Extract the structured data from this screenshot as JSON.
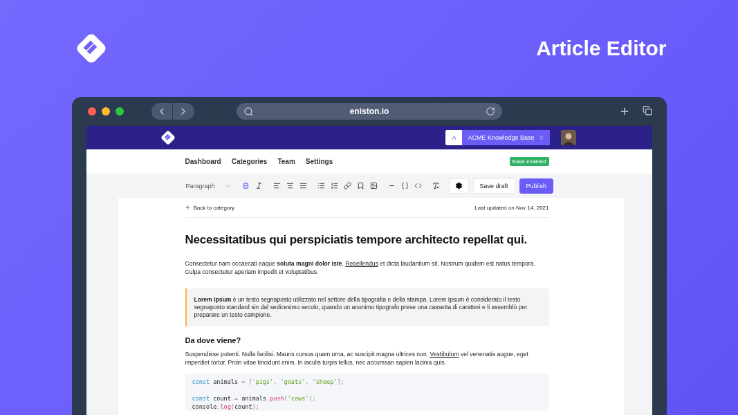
{
  "hero": {
    "title": "Article Editor"
  },
  "browser": {
    "url": "eniston.io"
  },
  "app_header": {
    "workspace_initial": "A",
    "workspace_name": "ACME Knowledge Base"
  },
  "nav": {
    "items": [
      {
        "label": "Dashboard"
      },
      {
        "label": "Categories"
      },
      {
        "label": "Team"
      },
      {
        "label": "Settings"
      }
    ],
    "badge": "Base enabled"
  },
  "toolbar": {
    "block_type": "Paragraph",
    "tools": [
      [
        {
          "active": true
        },
        {
          "active": false
        }
      ],
      [
        {
          "active": false
        },
        {
          "active": false
        },
        {
          "active": false
        }
      ],
      [
        {
          "active": false
        },
        {
          "active": false
        },
        {
          "active": false
        },
        {
          "active": false
        },
        {
          "active": false
        }
      ],
      [
        {
          "active": false
        },
        {
          "active": false
        },
        {
          "active": false
        }
      ],
      [
        {
          "active": false
        }
      ]
    ],
    "save_label": "Save draft",
    "publish_label": "Publish"
  },
  "article": {
    "back_link": "Back to category",
    "updated": "Last updated on Nov 14, 2021",
    "title": "Necessitatibus qui perspiciatis tempore architecto repellat qui.",
    "blocks": [
      {
        "kind": "paragraph",
        "parts": [
          {
            "kind": "text",
            "text": "Consectetur nam occaecati eaque **soluta magni dolor iste**. "
          },
          {
            "kind": "link",
            "text": "Repellendus"
          },
          {
            "kind": "text",
            "text": " et dicta laudantium sit. Nostrum quidem est natus tempora. Culpa consectetur aperiam impedit et voluptatibus."
          }
        ]
      },
      {
        "kind": "quote",
        "text": "**Lorem Ipsum** è un testo segnaposto utilizzato nel settore della tipografia e della stampa. Lorem Ipsum è considerato il testo segnaposto standard sin dal sedicesimo secolo, quando un anonimo tipografo prese una cassetta di caratteri e li assemblò per preparare un testo campione."
      },
      {
        "kind": "heading",
        "text": "Da dove viene?"
      },
      {
        "kind": "paragraph",
        "parts": [
          {
            "kind": "text",
            "text": "Suspendisse potenti. Nulla facilisi. Mauris cursus quam urna, ac suscipit magna ultrices non. "
          },
          {
            "kind": "link",
            "text": "Vestibulum"
          },
          {
            "kind": "text",
            "text": " vel venenatis augue, eget imperdiet tortor. Proin vitae tincidunt enim. In iaculis turpis tellus, nec accumsan sapien lacinia quis."
          }
        ]
      },
      {
        "kind": "code",
        "groups": [
          [
            [
              {
                "kind": "keyword",
                "text": "const"
              },
              {
                "kind": "plain",
                "text": " animals "
              },
              {
                "kind": "punct",
                "text": "= ["
              },
              {
                "kind": "string",
                "text": "'pigs'"
              },
              {
                "kind": "punct",
                "text": ", "
              },
              {
                "kind": "string",
                "text": "'goats'"
              },
              {
                "kind": "punct",
                "text": ", "
              },
              {
                "kind": "string",
                "text": "'sheep'"
              },
              {
                "kind": "punct",
                "text": "];"
              }
            ]
          ],
          [
            [
              {
                "kind": "keyword",
                "text": "const"
              },
              {
                "kind": "plain",
                "text": " count "
              },
              {
                "kind": "punct",
                "text": "="
              },
              {
                "kind": "plain",
                "text": " animals"
              },
              {
                "kind": "punct",
                "text": "."
              },
              {
                "kind": "func",
                "text": "push"
              },
              {
                "kind": "punct",
                "text": "("
              },
              {
                "kind": "string",
                "text": "'cows'"
              },
              {
                "kind": "punct",
                "text": ");"
              }
            ],
            [
              {
                "kind": "plain",
                "text": "console"
              },
              {
                "kind": "punct",
                "text": "."
              },
              {
                "kind": "func",
                "text": "log"
              },
              {
                "kind": "punct",
                "text": "("
              },
              {
                "kind": "plain",
                "text": "count"
              },
              {
                "kind": "punct",
                "text": ");"
              }
            ]
          ]
        ]
      }
    ]
  }
}
